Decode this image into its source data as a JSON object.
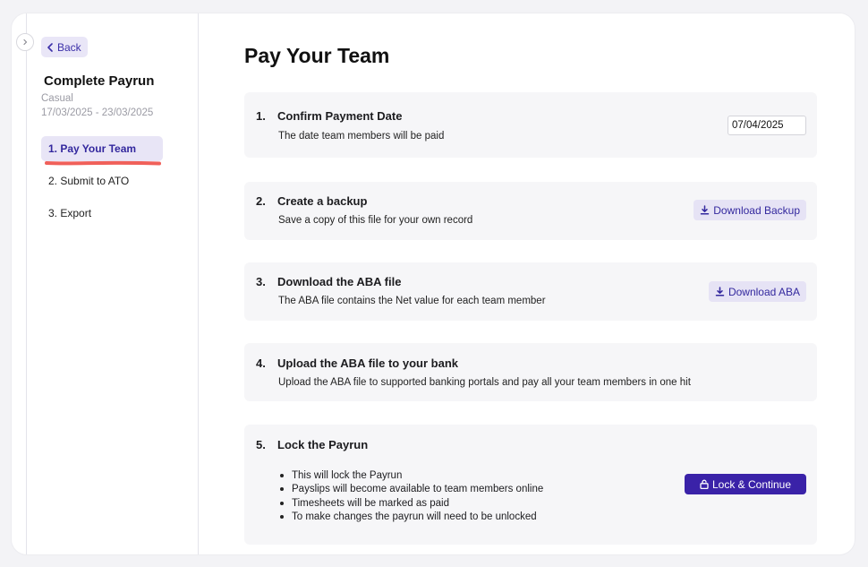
{
  "sidebar": {
    "back_label": "Back",
    "title": "Complete Payrun",
    "pay_type": "Casual",
    "period": "17/03/2025 - 23/03/2025",
    "nav": [
      {
        "label": "1. Pay Your Team",
        "active": true
      },
      {
        "label": "2. Submit to ATO",
        "active": false
      },
      {
        "label": "3. Export",
        "active": false
      }
    ],
    "highlight_color": "#f0605a"
  },
  "main": {
    "title": "Pay Your Team",
    "steps": [
      {
        "num": "1.",
        "title": "Confirm Payment Date",
        "desc": "The date team members will be paid",
        "input_value": "07/04/2025"
      },
      {
        "num": "2.",
        "title": "Create a backup",
        "desc": "Save a copy of this file for your own record",
        "button_label": "Download Backup",
        "button_icon": "download-icon"
      },
      {
        "num": "3.",
        "title": "Download the ABA file",
        "desc": "The ABA file contains the Net value for each team member",
        "button_label": "Download ABA",
        "button_icon": "download-icon"
      },
      {
        "num": "4.",
        "title": "Upload the ABA file to your bank",
        "desc": "Upload the ABA file to supported banking portals and pay all your team members in one hit"
      },
      {
        "num": "5.",
        "title": "Lock the Payrun",
        "bullets": [
          "This will lock the Payrun",
          "Payslips will become available to team members online",
          "Timesheets will be marked as paid",
          "To make changes the payrun will need to be unlocked"
        ],
        "button_label": "Lock & Continue",
        "button_icon": "lock-icon"
      }
    ]
  },
  "colors": {
    "accent": "#3a22a8",
    "accent_soft": "#e6e3f5",
    "card_bg": "#f6f6f8"
  }
}
